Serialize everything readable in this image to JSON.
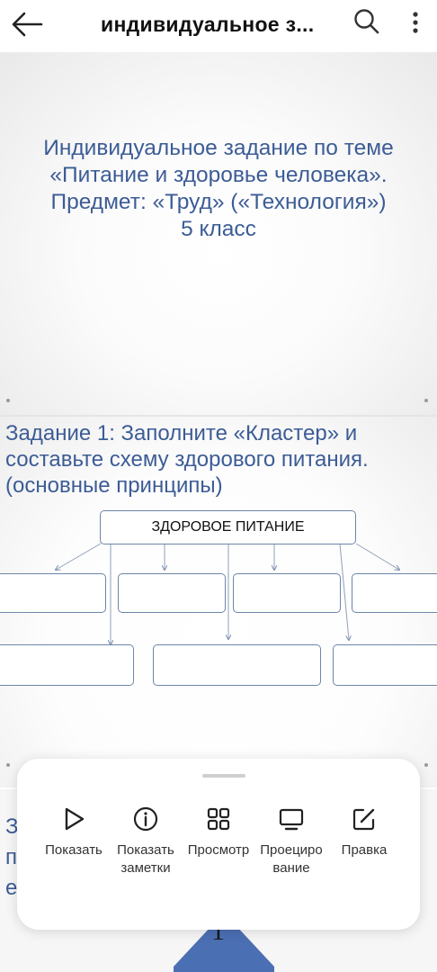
{
  "topbar": {
    "title": "индивидуальное з...",
    "icons": [
      "back-arrow-icon",
      "search-icon",
      "more-vertical-icon"
    ]
  },
  "slide1": {
    "line1": "Индивидуальное задание по теме",
    "line2": "«Питание и здоровье человека».",
    "line3": "Предмет: «Труд» («Технология»)",
    "line4": "5 класс"
  },
  "slide2": {
    "line1": "Задание 1: Заполните «Кластер» и",
    "line2": "составьте схему здорового питания.",
    "line3": "(основные принципы)",
    "cluster_center": "ЗДОРОВОЕ ПИТАНИЕ"
  },
  "slide3": {
    "partial_chars": [
      "З",
      "п",
      "е"
    ],
    "logo_char": "1"
  },
  "sheet": {
    "actions": [
      {
        "label": "Показать",
        "icon": "play-icon"
      },
      {
        "label": "Показать\nзаметки",
        "icon": "info-icon"
      },
      {
        "label": "Просмотр",
        "icon": "grid-icon"
      },
      {
        "label": "Проециро\nвание",
        "icon": "monitor-icon"
      },
      {
        "label": "Правка",
        "icon": "edit-icon"
      }
    ]
  },
  "colors": {
    "slide_text": "#3c5c96",
    "box_border": "#6d86a8",
    "logo_blue": "#4b6fb3"
  }
}
